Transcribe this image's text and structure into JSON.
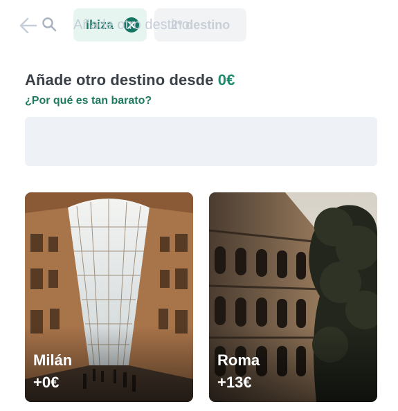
{
  "header": {
    "back_icon": "arrow-left-icon",
    "chips": [
      {
        "label": "Ibiza",
        "state": "selected",
        "icon": "close-circle-icon",
        "color": "#157563"
      },
      {
        "label": "2º destino",
        "state": "empty"
      }
    ]
  },
  "main": {
    "heading_prefix": "Añade otro destino desde ",
    "heading_price": "0€",
    "why_link": "¿Por qué es tan barato?",
    "search": {
      "icon": "search-icon",
      "value": "",
      "placeholder": "Añade otro destino"
    },
    "destinations": [
      {
        "city": "Milán",
        "price": "+0€",
        "image": "galleria-arcade-photo"
      },
      {
        "city": "Roma",
        "price": "+13€",
        "image": "colosseum-photo"
      }
    ]
  },
  "colors": {
    "accent": "#1f8a6e",
    "chip_active_bg": "#e6f5f0",
    "chip_inactive_bg": "#f1f3f5",
    "search_bg": "#eef2f7"
  }
}
